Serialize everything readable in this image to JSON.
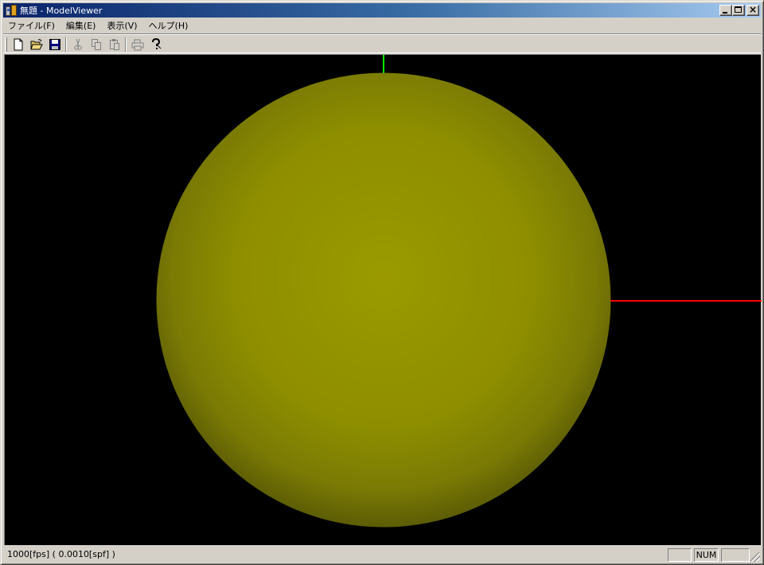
{
  "window": {
    "title": "無題 - ModelViewer"
  },
  "menubar": {
    "items": [
      {
        "label": "ファイル(F)"
      },
      {
        "label": "編集(E)"
      },
      {
        "label": "表示(V)"
      },
      {
        "label": "ヘルプ(H)"
      }
    ]
  },
  "toolbar": {
    "buttons": [
      {
        "icon": "new-file-icon"
      },
      {
        "icon": "open-folder-icon"
      },
      {
        "icon": "save-disk-icon"
      },
      {
        "icon": "cut-scissors-icon"
      },
      {
        "icon": "copy-icon"
      },
      {
        "icon": "paste-icon"
      },
      {
        "icon": "print-icon"
      },
      {
        "icon": "help-icon"
      }
    ]
  },
  "viewport": {
    "background": "#000000",
    "sphere_color": "#9a9a00",
    "axis_x_color": "#ff0000",
    "axis_y_color": "#00ff00"
  },
  "statusbar": {
    "text": "1000[fps] ( 0.0010[spf] )",
    "caps": "",
    "num": "NUM",
    "scrl": ""
  }
}
